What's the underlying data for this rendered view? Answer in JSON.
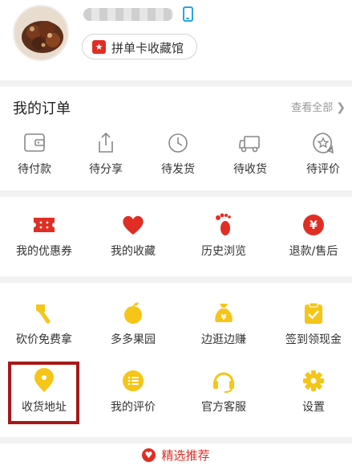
{
  "profile": {
    "card_badge": "★",
    "card_label": "拼单卡收藏馆",
    "colors": {
      "card_badge": "#e02e24",
      "phone_icon": "#28a4e3"
    }
  },
  "orders": {
    "title": "我的订单",
    "view_all": "查看全部",
    "view_all_icon": "chevron-right-icon",
    "items": [
      {
        "label": "待付款",
        "icon": "wallet-icon"
      },
      {
        "label": "待分享",
        "icon": "share-icon"
      },
      {
        "label": "待发货",
        "icon": "clock-icon"
      },
      {
        "label": "待收货",
        "icon": "truck-icon"
      },
      {
        "label": "待评价",
        "icon": "review-icon"
      }
    ]
  },
  "services": {
    "items": [
      {
        "label": "我的优惠券",
        "icon": "coupon-icon"
      },
      {
        "label": "我的收藏",
        "icon": "heart-icon"
      },
      {
        "label": "历史浏览",
        "icon": "footprint-icon"
      },
      {
        "label": "退款/售后",
        "icon": "refund-icon"
      }
    ]
  },
  "tools": {
    "row1": [
      {
        "label": "砍价免费拿",
        "icon": "axe-icon"
      },
      {
        "label": "多多果园",
        "icon": "fruit-icon"
      },
      {
        "label": "边逛边赚",
        "icon": "money-bag-icon"
      },
      {
        "label": "签到领现金",
        "icon": "checkin-icon"
      }
    ],
    "row2": [
      {
        "label": "收货地址",
        "icon": "location-icon"
      },
      {
        "label": "我的评价",
        "icon": "comment-list-icon"
      },
      {
        "label": "官方客服",
        "icon": "headset-icon"
      },
      {
        "label": "设置",
        "icon": "gear-icon"
      }
    ]
  },
  "recommend": {
    "label": "精选推荐"
  },
  "colors": {
    "accent_red": "#e02e24",
    "accent_yellow": "#f5c518",
    "outline_gray": "#888888",
    "highlight_box": "#a81818"
  }
}
